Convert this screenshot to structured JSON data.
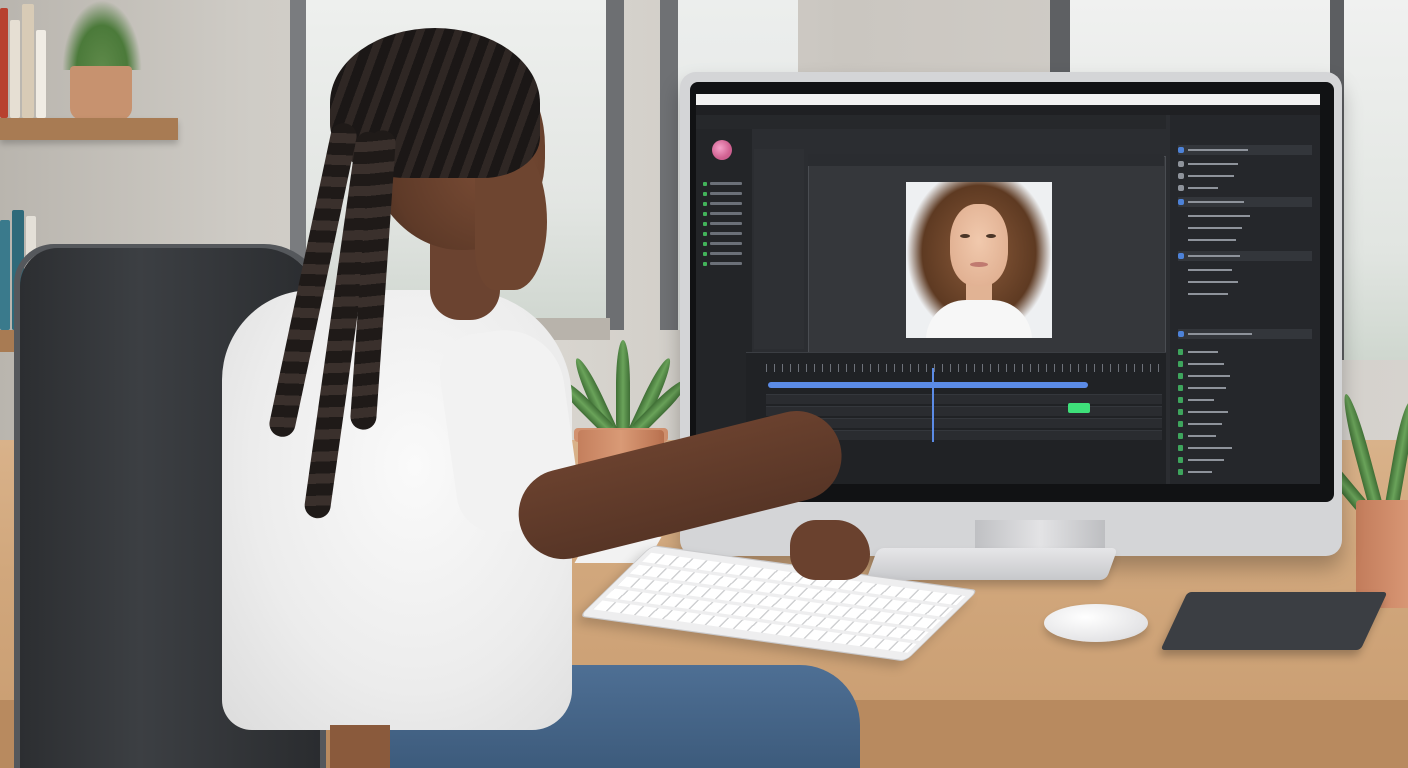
{
  "scene": {
    "description_type": "photo of a person editing an image on a desktop monitor",
    "accent_blue": "#5b8be6",
    "accent_green": "#3ee07a",
    "ui_background": "#2b2d31"
  },
  "screen_ui": {
    "icons": [
      "avatar-icon",
      "layer-icon",
      "timeline-icon",
      "playhead-icon"
    ]
  }
}
